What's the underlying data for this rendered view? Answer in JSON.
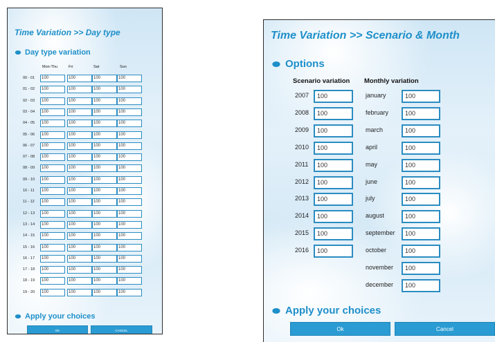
{
  "daytype": {
    "title": "Time Variation >> Day type",
    "section": "Day type variation",
    "columns": [
      "Mon-Thu",
      "Fri",
      "Sat",
      "Sun"
    ],
    "rows": [
      {
        "label": "00 - 01",
        "values": [
          "100",
          "100",
          "100",
          "100"
        ]
      },
      {
        "label": "01 - 02",
        "values": [
          "100",
          "100",
          "100",
          "100"
        ]
      },
      {
        "label": "02 - 03",
        "values": [
          "100",
          "100",
          "100",
          "100"
        ]
      },
      {
        "label": "03 - 04",
        "values": [
          "100",
          "100",
          "100",
          "100"
        ]
      },
      {
        "label": "04 - 05",
        "values": [
          "100",
          "100",
          "100",
          "100"
        ]
      },
      {
        "label": "05 - 06",
        "values": [
          "100",
          "100",
          "100",
          "100"
        ]
      },
      {
        "label": "06 - 07",
        "values": [
          "100",
          "100",
          "100",
          "100"
        ]
      },
      {
        "label": "07 - 08",
        "values": [
          "100",
          "100",
          "100",
          "100"
        ]
      },
      {
        "label": "08 - 09",
        "values": [
          "100",
          "100",
          "100",
          "100"
        ]
      },
      {
        "label": "09 - 10",
        "values": [
          "100",
          "100",
          "100",
          "100"
        ]
      },
      {
        "label": "10 - 11",
        "values": [
          "100",
          "100",
          "100",
          "100"
        ]
      },
      {
        "label": "11 - 12",
        "values": [
          "100",
          "100",
          "100",
          "100"
        ]
      },
      {
        "label": "12 - 13",
        "values": [
          "100",
          "100",
          "100",
          "100"
        ]
      },
      {
        "label": "13 - 14",
        "values": [
          "100",
          "100",
          "100",
          "100"
        ]
      },
      {
        "label": "14 - 15",
        "values": [
          "100",
          "100",
          "100",
          "100"
        ]
      },
      {
        "label": "15 - 16",
        "values": [
          "100",
          "100",
          "100",
          "100"
        ]
      },
      {
        "label": "16 - 17",
        "values": [
          "100",
          "100",
          "100",
          "100"
        ]
      },
      {
        "label": "17 - 18",
        "values": [
          "100",
          "100",
          "100",
          "100"
        ]
      },
      {
        "label": "18 - 19",
        "values": [
          "100",
          "100",
          "100",
          "100"
        ]
      },
      {
        "label": "19 - 20",
        "values": [
          "100",
          "100",
          "100",
          "100"
        ]
      }
    ],
    "apply": "Apply your choices",
    "ok": "OK",
    "cancel": "CANCEL"
  },
  "scenario": {
    "title": "Time Variation >> Scenario & Month",
    "section": "Options",
    "scenario_header": "Scenario variation",
    "monthly_header": "Monthly variation",
    "years": [
      {
        "label": "2007",
        "value": "100"
      },
      {
        "label": "2008",
        "value": "100"
      },
      {
        "label": "2009",
        "value": "100"
      },
      {
        "label": "2010",
        "value": "100"
      },
      {
        "label": "2011",
        "value": "100"
      },
      {
        "label": "2012",
        "value": "100"
      },
      {
        "label": "2013",
        "value": "100"
      },
      {
        "label": "2014",
        "value": "100"
      },
      {
        "label": "2015",
        "value": "100"
      },
      {
        "label": "2016",
        "value": "100"
      }
    ],
    "months": [
      {
        "label": "january",
        "value": "100"
      },
      {
        "label": "february",
        "value": "100"
      },
      {
        "label": "march",
        "value": "100"
      },
      {
        "label": "april",
        "value": "100"
      },
      {
        "label": "may",
        "value": "100"
      },
      {
        "label": "june",
        "value": "100"
      },
      {
        "label": "july",
        "value": "100"
      },
      {
        "label": "august",
        "value": "100"
      },
      {
        "label": "september",
        "value": "100"
      },
      {
        "label": "october",
        "value": "100"
      },
      {
        "label": "november",
        "value": "100"
      },
      {
        "label": "december",
        "value": "100"
      }
    ],
    "apply": "Apply your choices",
    "ok": "Ok",
    "cancel": "Cancel"
  },
  "colors": {
    "accent": "#1e8fc9",
    "button": "#2a9bd3",
    "input_border": "#2a8cc1"
  },
  "icons": {
    "bullet": "bullet-icon"
  }
}
